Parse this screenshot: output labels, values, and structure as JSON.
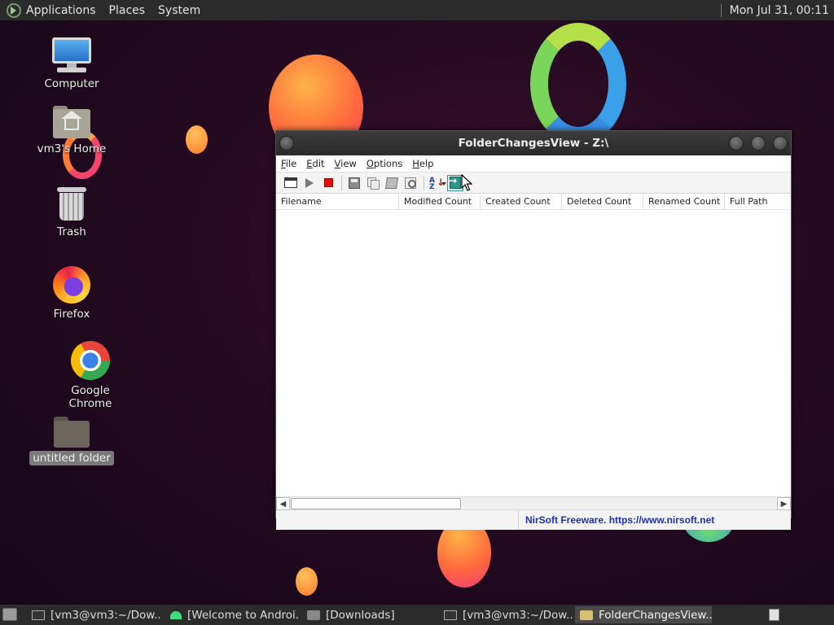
{
  "top_panel": {
    "menus": [
      "Applications",
      "Places",
      "System"
    ],
    "clock": "Mon Jul 31, 00:11"
  },
  "desktop": {
    "icons": [
      {
        "label": "Computer",
        "icon": "computer-icon"
      },
      {
        "label": "vm3's Home",
        "icon": "home-folder-icon"
      },
      {
        "label": "Trash",
        "icon": "trash-icon"
      },
      {
        "label": "Firefox",
        "icon": "firefox-icon"
      },
      {
        "label": "Google Chrome",
        "icon": "chrome-icon"
      },
      {
        "label": "untitled folder",
        "icon": "folder-icon"
      }
    ]
  },
  "window": {
    "title": "FolderChangesView  -  Z:\\",
    "menu": [
      "File",
      "Edit",
      "View",
      "Options",
      "Help"
    ],
    "toolbar": [
      "properties-icon",
      "start-icon",
      "stop-icon",
      "save-icon",
      "copy-icon",
      "html-report-icon",
      "find-icon",
      "sort-icon",
      "exit-icon"
    ],
    "columns": [
      "Filename",
      "Modified Count",
      "Created Count",
      "Deleted Count",
      "Renamed Count",
      "Full Path"
    ],
    "rows": [],
    "status_left": "",
    "status_right": "NirSoft Freeware. https://www.nirsoft.net",
    "colors": {
      "status_link": "#1b2fb8",
      "stop": "#e01010"
    }
  },
  "taskbar": {
    "tasks": [
      {
        "label": "[vm3@vm3:~/Dow...",
        "icon": "terminal-icon"
      },
      {
        "label": "[Welcome to Androi...",
        "icon": "android-icon"
      },
      {
        "label": "[Downloads]",
        "icon": "folder-icon"
      },
      {
        "label": "[vm3@vm3:~/Dow...",
        "icon": "terminal-icon"
      },
      {
        "label": "FolderChangesView...",
        "icon": "folder-icon",
        "active": true
      }
    ]
  }
}
